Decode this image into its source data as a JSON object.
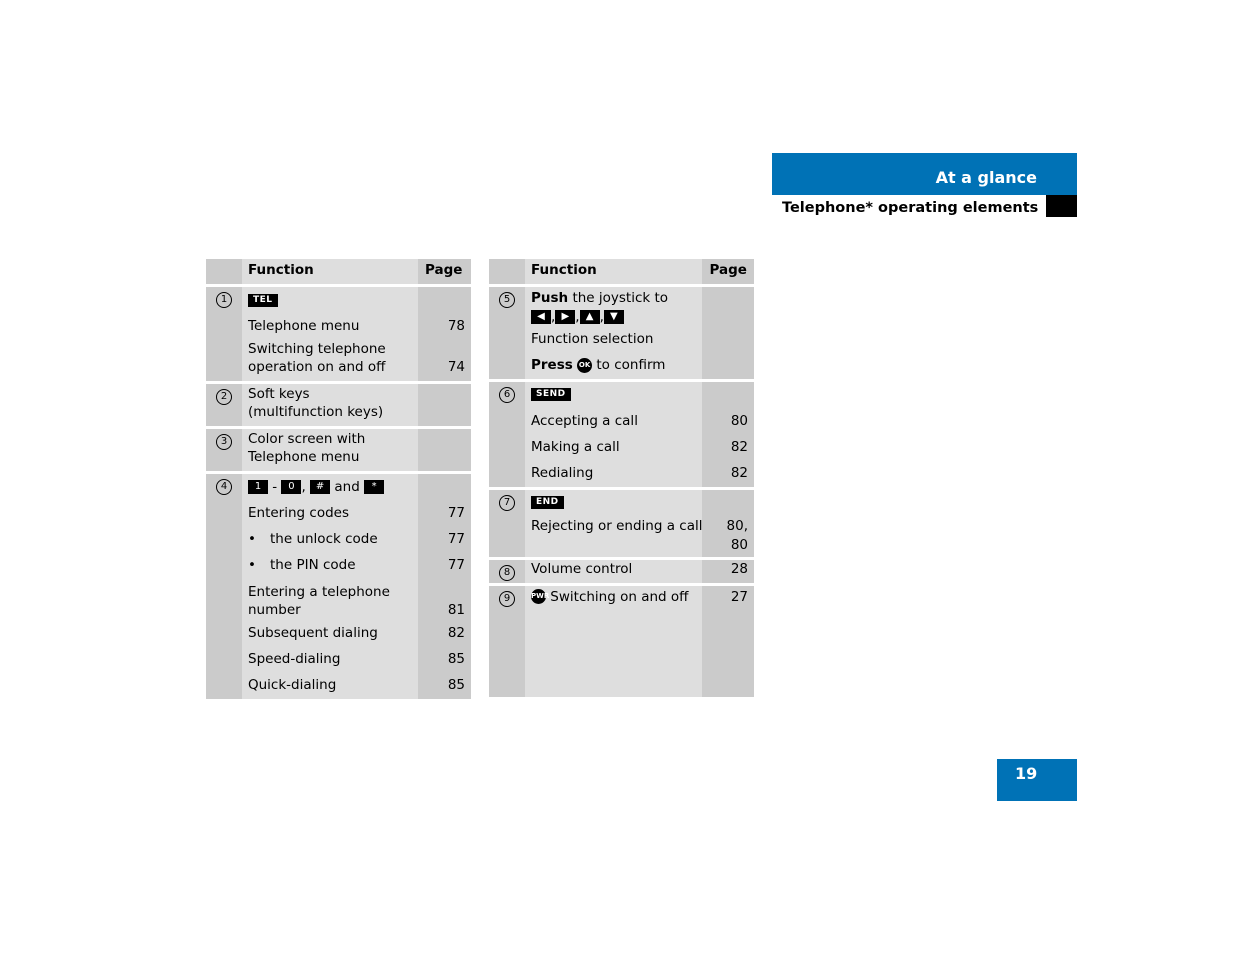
{
  "header": {
    "section_title": "At a glance",
    "subtitle": "Telephone* operating elements",
    "accent_color": "#0072b6"
  },
  "page_number": "19",
  "tables": {
    "column_headers": {
      "function": "Function",
      "page": "Page"
    },
    "left": {
      "item1": {
        "num": "1",
        "key": "TEL",
        "lines": [
          {
            "text": "Telephone menu",
            "page": "78"
          },
          {
            "text_l1": "Switching telephone",
            "text_l2": "operation on and off",
            "page": "74"
          }
        ]
      },
      "item2": {
        "num": "2",
        "l1": "Soft keys",
        "l2": "(multifunction keys)"
      },
      "item3": {
        "num": "3",
        "l1": "Color screen with",
        "l2": "Telephone menu"
      },
      "item4": {
        "num": "4",
        "keys": {
          "k1": "1",
          "dash": "-",
          "k0": "0",
          "comma": ",",
          "khash": "#",
          "and": "and",
          "kstar": "*"
        },
        "lines": [
          {
            "text": "Entering codes",
            "page": "77"
          },
          {
            "bullet": "•",
            "text": "the unlock code",
            "page": "77"
          },
          {
            "bullet": "•",
            "text": "the PIN code",
            "page": "77"
          },
          {
            "text_l1": "Entering a telephone",
            "text_l2": "number",
            "page": "81"
          },
          {
            "text": "Subsequent dialing",
            "page": "82"
          },
          {
            "text": "Speed-dialing",
            "page": "85"
          },
          {
            "text": "Quick-dialing",
            "page": "85"
          }
        ]
      }
    },
    "right": {
      "item5": {
        "num": "5",
        "push": "Push",
        "push_rest": "the joystick to",
        "arrows": [
          "◀",
          "▶",
          "▲",
          "▼"
        ],
        "sep": ",",
        "selection": "Function selection",
        "press": "Press",
        "ok_key": "OK",
        "confirm": "to confirm"
      },
      "item6": {
        "num": "6",
        "key": "SEND",
        "lines": [
          {
            "text": "Accepting a call",
            "page": "80"
          },
          {
            "text": "Making a call",
            "page": "82"
          },
          {
            "text": "Redialing",
            "page": "82"
          }
        ]
      },
      "item7": {
        "num": "7",
        "key": "END",
        "text": "Rejecting or ending a call",
        "page_l1": "80,",
        "page_l2": "80"
      },
      "item8": {
        "num": "8",
        "text": "Volume control",
        "page": "28"
      },
      "item9": {
        "num": "9",
        "key": "PWR",
        "text": "Switching on and off",
        "page": "27"
      }
    }
  }
}
